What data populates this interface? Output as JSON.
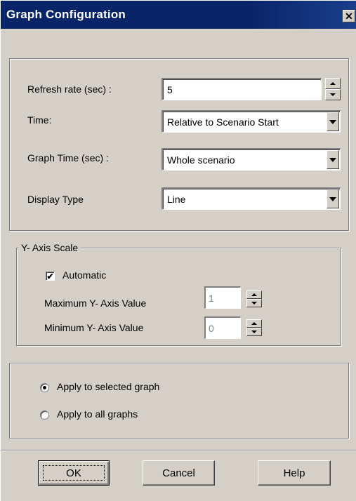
{
  "window": {
    "title": "Graph Configuration",
    "close_glyph": "✕"
  },
  "settings": {
    "refresh_rate": {
      "label": "Refresh rate (sec) :",
      "value": "5"
    },
    "time": {
      "label": "Time:",
      "value": "Relative to Scenario Start"
    },
    "graph_time": {
      "label": "Graph Time (sec) :",
      "value": "Whole scenario"
    },
    "display_type": {
      "label": "Display Type",
      "value": "Line"
    }
  },
  "y_axis": {
    "legend": "Y- Axis Scale",
    "automatic_label": "Automatic",
    "automatic_checked": true,
    "max_label": "Maximum Y- Axis Value",
    "max_value": "1",
    "min_label": "Minimum  Y- Axis Value",
    "min_value": "0"
  },
  "apply": {
    "selected_label": "Apply to selected graph",
    "all_label": "Apply to all graphs",
    "selected": "selected"
  },
  "buttons": {
    "ok": "OK",
    "cancel": "Cancel",
    "help": "Help"
  },
  "icons": {
    "close": "close-icon",
    "dropdown": "chevron-down-icon",
    "spin_up": "arrow-up-icon",
    "spin_down": "arrow-down-icon",
    "check": "checkmark-icon"
  },
  "colors": {
    "title_bar": "#0a246a",
    "face": "#d4d0c8"
  }
}
